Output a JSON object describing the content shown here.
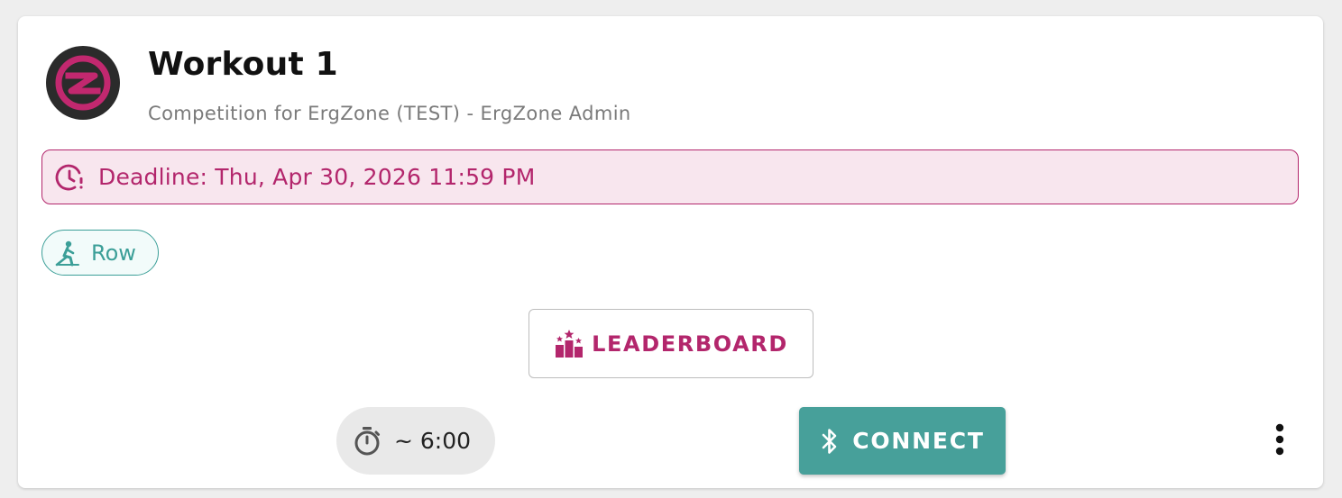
{
  "workout": {
    "title": "Workout 1",
    "subtitle": "Competition for ErgZone (TEST) - ErgZone Admin",
    "logo_icon": "ergzone-logo-icon"
  },
  "deadline": {
    "text": "Deadline: Thu, Apr 30, 2026 11:59 PM",
    "icon": "clock-alert-icon",
    "color": "#b3266c",
    "background": "#f8e6ee"
  },
  "activity_chip": {
    "label": "Row",
    "icon": "rowing-icon",
    "color": "#3c9f98"
  },
  "leaderboard_button": {
    "label": "LEADERBOARD",
    "icon": "podium-stars-icon",
    "color": "#b3266c"
  },
  "duration": {
    "text": "~ 6:00",
    "icon": "timer-icon"
  },
  "connect_button": {
    "label": "CONNECT",
    "icon": "bluetooth-icon",
    "background": "#47a09a"
  },
  "more_menu": {
    "icon": "more-vertical-icon"
  }
}
